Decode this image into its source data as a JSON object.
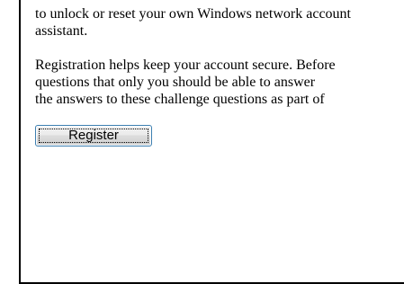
{
  "content": {
    "paragraph1_line1": "to unlock or reset your own Windows network account",
    "paragraph1_line2": "assistant.",
    "paragraph2_line1": "Registration helps keep your account secure. Before",
    "paragraph2_line2": "questions that only you should be able to answer",
    "paragraph2_line3": "the answers to these challenge questions as part of"
  },
  "register_button": {
    "label": "Register"
  }
}
